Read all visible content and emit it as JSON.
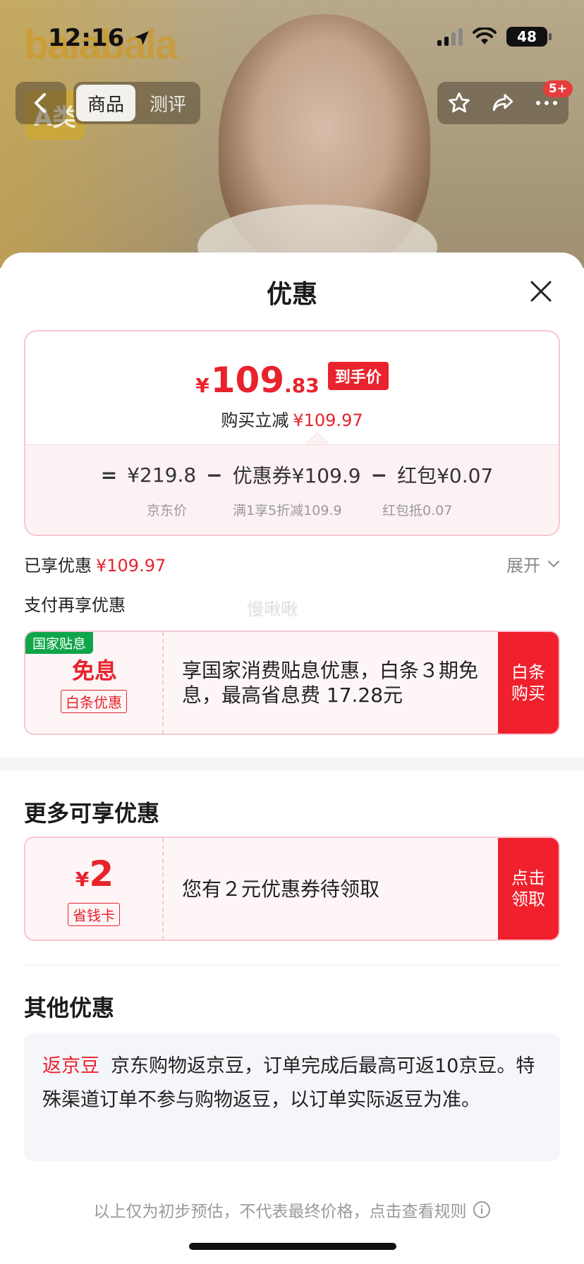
{
  "status_bar": {
    "time": "12:16",
    "battery": "48"
  },
  "background": {
    "brand_logo": "balabala",
    "brand_badge": "A类"
  },
  "nav": {
    "tabs": [
      {
        "label": "商品",
        "active": true
      },
      {
        "label": "测评",
        "active": false
      }
    ],
    "badge": "5+"
  },
  "sheet": {
    "title": "优惠",
    "final_price": {
      "currency": "¥",
      "integer": "109",
      "decimal": ".83",
      "tag": "到手价"
    },
    "instant_reduce": {
      "label": "购买立减",
      "amount": "¥109.97"
    },
    "breakdown": {
      "eq": "=",
      "items": [
        {
          "value": "¥219.8",
          "desc": "京东价"
        },
        {
          "value": "优惠券¥109.9",
          "desc": "满1享5折减109.9"
        },
        {
          "value": "红包¥0.07",
          "desc": "红包抵0.07"
        }
      ],
      "minus": "−"
    },
    "enjoyed": {
      "label": "已享优惠",
      "amount": "¥109.97",
      "expand": "展开"
    },
    "pay_more": "支付再享优惠",
    "watermark": "慢啾啾",
    "baitiao_offer": {
      "gov_tag": "国家贴息",
      "main": "免息",
      "sub_tag": "白条优惠",
      "text": "享国家消费贴息优惠，白条３期免息，最高省息费 17.28元",
      "button": "白条购买"
    },
    "more_section": {
      "title": "更多可享优惠",
      "coupon": {
        "currency": "¥",
        "amount": "2",
        "sub_tag": "省钱卡",
        "text": "您有２元优惠券待领取",
        "button": "点击领取"
      }
    },
    "other_section": {
      "title": "其他优惠",
      "tag": "返京豆",
      "text": "京东购物返京豆，订单完成后最高可返10京豆。特殊渠道订单不参与购物返豆，以订单实际返豆为准。"
    },
    "footer": "以上仅为初步预估，不代表最终价格，点击查看规则"
  },
  "colors": {
    "accent_red": "#e8232d",
    "button_red": "#f0202d",
    "gov_green": "#10a54a"
  }
}
